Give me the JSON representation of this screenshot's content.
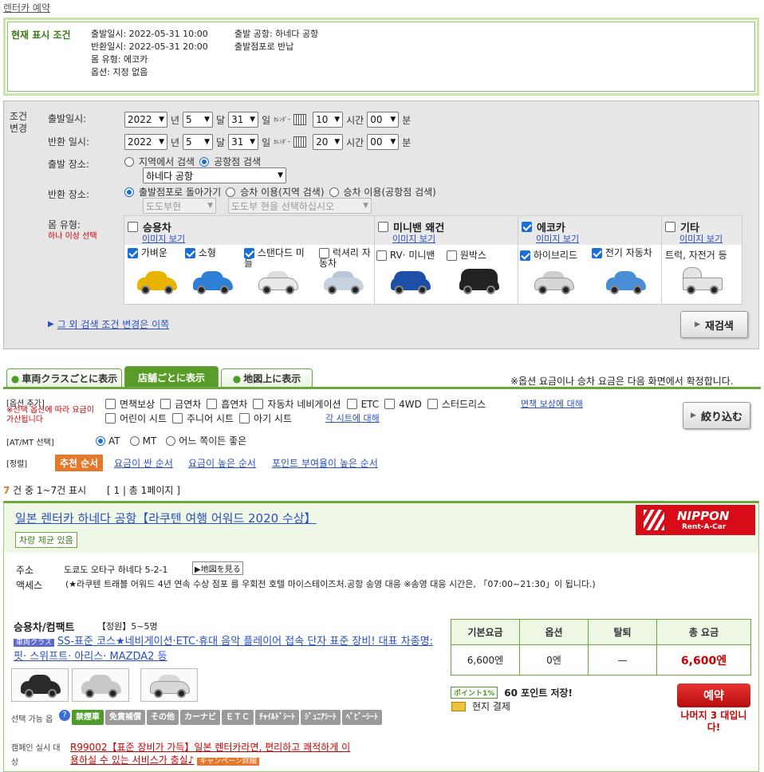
{
  "breadcrumb": "렌터카 예약",
  "current": {
    "title": "현재 표시 조건",
    "depart_dt": "출발일시: 2022-05-31 10:00",
    "return_dt": "반환일시: 2022-05-31 20:00",
    "car_type": "몸 유형: 에코카",
    "options": "옵션: 지정 없음",
    "depart_airport": "출발 공항: 하네다 공항",
    "return_place": "출발점포로 반납"
  },
  "change": {
    "label": "조건 변경",
    "depart_label": "출발일시:",
    "return_label": "반환 일시:",
    "year": "2022",
    "month": "5",
    "day": "31",
    "depart_hour": "10",
    "return_hour": "20",
    "minute": "00",
    "u_year": "년",
    "u_month": "달",
    "u_day": "일",
    "u_hour": "시간",
    "u_min": "분",
    "calendar_text": "ｶﾚﾝﾀﾞｰ",
    "depart_place_label": "출발 장소:",
    "opt_region": "지역에서 검색",
    "opt_airport": "공항점 검색",
    "airport_value": "하네다 공항",
    "return_place_label": "반환 장소:",
    "opt_return_same": "출발점포로 돌아가기",
    "opt_ride_region": "승차 이용(지역 검색)",
    "opt_ride_airport": "승차 이용(공항점 검색)",
    "pref_placeholder": "도도부현",
    "pref_select_placeholder": "도도부 현을 선택하십시오",
    "car_type_label": "몸 유형:",
    "car_type_note": "하나 이상 선택",
    "more_link": "그 외 검색 조건 변경은 이쪽",
    "research_button": "재검색"
  },
  "car_groups": [
    {
      "name": "승용차",
      "img_link": "이미지 보기",
      "checked": false
    },
    {
      "name": "미니밴 왜건",
      "img_link": "이미지 보기",
      "checked": false
    },
    {
      "name": "에코카",
      "img_link": "이미지 보기",
      "checked": true
    },
    {
      "name": "기타",
      "img_link": "이미지 보기",
      "checked": false
    }
  ],
  "car_subs": [
    {
      "name": "가벼운",
      "checked": true,
      "color": "#e8b400"
    },
    {
      "name": "소형",
      "checked": true,
      "color": "#2f7fd6"
    },
    {
      "name": "스탠다드 미들",
      "checked": true,
      "color": "#e8e8e8"
    },
    {
      "name": "럭셔리 자동차",
      "checked": false,
      "color": "#c7d2e0"
    },
    {
      "name": "RV· 미니밴",
      "checked": false,
      "color": "#1d4fa8"
    },
    {
      "name": "원박스",
      "checked": false,
      "color": "#222222"
    },
    {
      "name": "하이브리드",
      "checked": true,
      "color": "#d6d6d6"
    },
    {
      "name": "전기 자동차",
      "checked": true,
      "color": "#4a8ed6"
    },
    {
      "name": "트럭, 자전거 등",
      "checked": false,
      "color": "#e4e4e4"
    }
  ],
  "tabs": [
    {
      "label": "車両クラスごとに表示",
      "active": false
    },
    {
      "label": "店舗ごとに表示",
      "active": true
    },
    {
      "label": "地図上に表示",
      "active": false
    }
  ],
  "tabs_note": "※옵션 요금이나 승차 요금은 다음 화면에서 확정합니다.",
  "filter": {
    "options_label": "[옵션 추가]",
    "options_note": "※선택 옵션에 따라 요금이 가산됩니다",
    "items_row1": [
      "면책보상",
      "금연차",
      "흡연차",
      "자동차 네비게이션",
      "ETC",
      "4WD",
      "스터드리스"
    ],
    "items_row2": [
      "어린이 시트",
      "주니어 시트",
      "아기 시트"
    ],
    "link1": "면책 보상에 대해",
    "link2": "각 시트에 대해",
    "narrow_button": "絞り込む",
    "atmt_label": "[AT/MT 선택]",
    "at": "AT",
    "mt": "MT",
    "either": "어느 쪽이든 좋은",
    "sort_label": "[정렬]",
    "sort_active": "추천 순서",
    "sort_links": [
      "요금이 싼 순서",
      "요금이 높은 순서",
      "포인트 부여율이 높은 순서"
    ]
  },
  "count": {
    "num": "7",
    "text": " 건 중 1~7건 표시",
    "pages": "[ 1 | 총 1페이지 ]"
  },
  "result": {
    "shop_name": "일본 렌터카 하네다 공항【라쿠텐 여행 어워드 2020 수상】",
    "badge": "차량 제균 있음",
    "logo_text": "NIPPON",
    "logo_sub": "Rent-A-Car",
    "address_label": "주소",
    "address": "도쿄도 오타구 하네다 5-2-1",
    "map_button": "▶地図を見る",
    "access_label": "액세스",
    "access": "(★라쿠텐 트래블 어워드 4년 연속 수상 점포 를 우회전 호텔 마이스테이즈처.공항 송영 대응 ※송영 대응 시간은, 「07:00~21:30」이 됩니다.)",
    "car_class": "승용차/컴팩트",
    "capacity": "【정원】5~5명",
    "class_badge": "車両クラス",
    "class_desc": "SS-표준 코스★네비게이션·ETC·휴대 음악 플레이어 접속 단자 표준 장비! 대표 차종명: 핏· 스위프트· 아리스· MAZDA2 등",
    "price_headers": [
      "기본요금",
      "옵션",
      "탈퇴",
      "총 요금"
    ],
    "price_values": [
      "6,600엔",
      "0엔",
      "—",
      "6,600엔"
    ],
    "point_badge": "ポイント1%",
    "points": "60 포인트 저장!",
    "pay": "현지 결제",
    "reserve_button": "예약",
    "remaining": "나머지 3 대입니다!",
    "options_label": "선택 가능 옵",
    "options": [
      "禁煙車",
      "免責補償",
      "その他",
      "カーナビ",
      "ＥＴＣ",
      "ﾁｬｲﾙﾄﾞｼｰﾄ",
      "ｼﾞｭﾆｱｼｰﾄ",
      "ﾍﾞﾋﾞｰｼｰﾄ"
    ],
    "campaign_label": "캠페인 실시 대상",
    "campaign_text": "R99002【표준 장비가 가득】일본 렌터카라면, 편리하고 쾌적하게 이용하실 수 있는 서비스가 충실♪",
    "campaign_btn": "キャンペーン詳細",
    "thumb_colors": [
      "#2a2a2a",
      "#c8c8c8",
      "#d8d8d8"
    ]
  }
}
